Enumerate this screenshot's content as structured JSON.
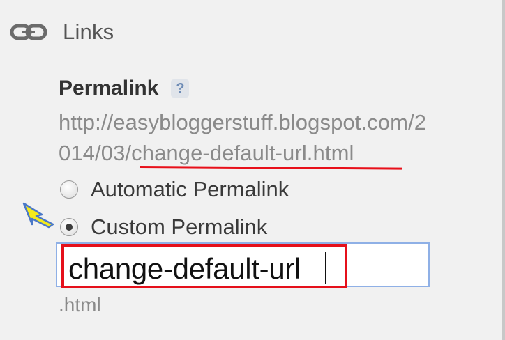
{
  "section": {
    "icon": "link-icon",
    "title": "Links"
  },
  "permalink": {
    "label": "Permalink",
    "help": "?",
    "url_line1": "http://easybloggerstuff.blogspot.com/2",
    "url_line2": "014/03/change-default-url.html",
    "options": [
      {
        "label": "Automatic Permalink",
        "checked": false
      },
      {
        "label": "Custom Permalink",
        "checked": true
      }
    ],
    "custom_value": "change-default-url",
    "suffix": ".html"
  },
  "annotations": {
    "accent_red": "#e5101b",
    "arrow_yellow": "#f4ea1c",
    "arrow_outline": "#4a78c8",
    "input_border": "#8fb0e6"
  }
}
